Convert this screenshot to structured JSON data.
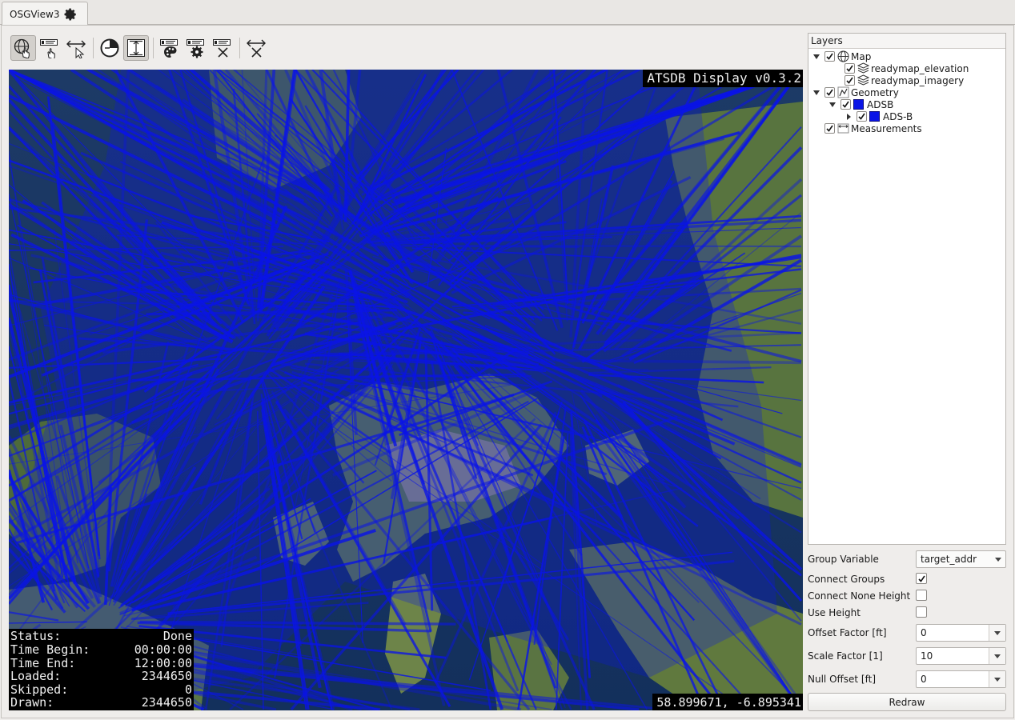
{
  "tab": {
    "label": "OSGView3",
    "icon": "gear-icon"
  },
  "toolbar": {
    "buttons": [
      {
        "name": "navigate-button",
        "icon": "globe-hand-icon",
        "active": true
      },
      {
        "name": "label-button",
        "icon": "label-hand-icon",
        "active": false
      },
      {
        "name": "measure-button",
        "icon": "measure-cursor-icon",
        "active": false
      },
      {
        "name": "time-filter-button",
        "icon": "clock-icon",
        "active": false
      },
      {
        "name": "height-toggle-button",
        "icon": "height-icon",
        "active": true
      },
      {
        "name": "style-button",
        "icon": "palette-icon",
        "active": false
      },
      {
        "name": "settings-button",
        "icon": "gear-icon",
        "active": false
      },
      {
        "name": "clear-labels-button",
        "icon": "clear-label-icon",
        "active": false
      },
      {
        "name": "clear-measurements-button",
        "icon": "clear-measure-icon",
        "active": false
      }
    ]
  },
  "viewport": {
    "title": "ATSDB Display v0.3.2",
    "coordinates": "58.899671, -6.895341",
    "status": [
      {
        "key": "Status:",
        "value": "Done"
      },
      {
        "key": "Time Begin:",
        "value": "00:00:00"
      },
      {
        "key": "Time End:",
        "value": "12:00:00"
      },
      {
        "key": "Loaded:",
        "value": "2344650"
      },
      {
        "key": "Skipped:",
        "value": "0"
      },
      {
        "key": "Drawn:",
        "value": "2344650"
      }
    ],
    "track_color": "#0a14e6"
  },
  "layers": {
    "header": "Layers",
    "items": [
      {
        "label": "Map",
        "checked": true,
        "expanded": true,
        "icon": "globe-icon"
      },
      {
        "label": "readymap_elevation",
        "checked": true,
        "icon": "layers-icon"
      },
      {
        "label": "readymap_imagery",
        "checked": true,
        "icon": "layers-icon"
      },
      {
        "label": "Geometry",
        "checked": true,
        "expanded": true,
        "icon": "geometry-icon"
      },
      {
        "label": "ADSB",
        "checked": true,
        "expanded": true,
        "color": "#0a14e6"
      },
      {
        "label": "ADS-B",
        "checked": true,
        "expanded": false,
        "color": "#0a14e6"
      },
      {
        "label": "Measurements",
        "checked": true,
        "icon": "ruler-icon"
      }
    ]
  },
  "form": {
    "group_variable": {
      "label": "Group Variable",
      "value": "target_addr"
    },
    "connect_groups": {
      "label": "Connect Groups",
      "checked": true
    },
    "connect_none_height": {
      "label": "Connect None Height",
      "checked": false
    },
    "use_height": {
      "label": "Use Height",
      "checked": false
    },
    "offset_factor": {
      "label": "Offset Factor [ft]",
      "value": "0"
    },
    "scale_factor": {
      "label": "Scale Factor [1]",
      "value": "10"
    },
    "null_offset": {
      "label": "Null Offset [ft]",
      "value": "0"
    },
    "redraw_label": "Redraw"
  }
}
